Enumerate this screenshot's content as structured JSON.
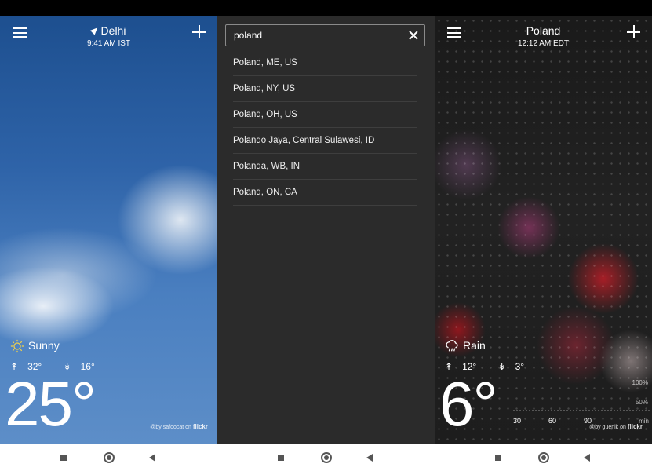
{
  "panel1": {
    "city": "Delhi",
    "time": "9:41 AM IST",
    "condition": "Sunny",
    "high": "32°",
    "low": "16°",
    "temp": "25°",
    "credit_by": "@by safoocat on",
    "credit_brand": "flickr"
  },
  "panel2": {
    "search_value": "poland",
    "results": [
      "Poland, ME, US",
      "Poland, NY, US",
      "Poland, OH, US",
      "Polando Jaya, Central Sulawesi, ID",
      "Polanda, WB, IN",
      "Poland, ON, CA"
    ]
  },
  "panel3": {
    "city": "Poland",
    "time": "12:12 AM EDT",
    "condition": "Rain",
    "high": "12°",
    "low": "3°",
    "temp": "6°",
    "credit_by": "@by guenik on",
    "credit_brand": "flickr",
    "chart_data": {
      "type": "line",
      "x": [
        30,
        60,
        90
      ],
      "x_tick_labels": [
        "30",
        "60",
        "90"
      ],
      "x_unit": "min",
      "y_tick_labels": [
        "100%",
        "50%"
      ]
    }
  },
  "icons": [
    "menu-icon",
    "add-icon",
    "location-arrow-icon",
    "sun-icon",
    "rain-cloud-icon",
    "high-temp-icon",
    "low-temp-icon",
    "clear-icon",
    "recents-icon",
    "home-icon",
    "back-icon"
  ]
}
